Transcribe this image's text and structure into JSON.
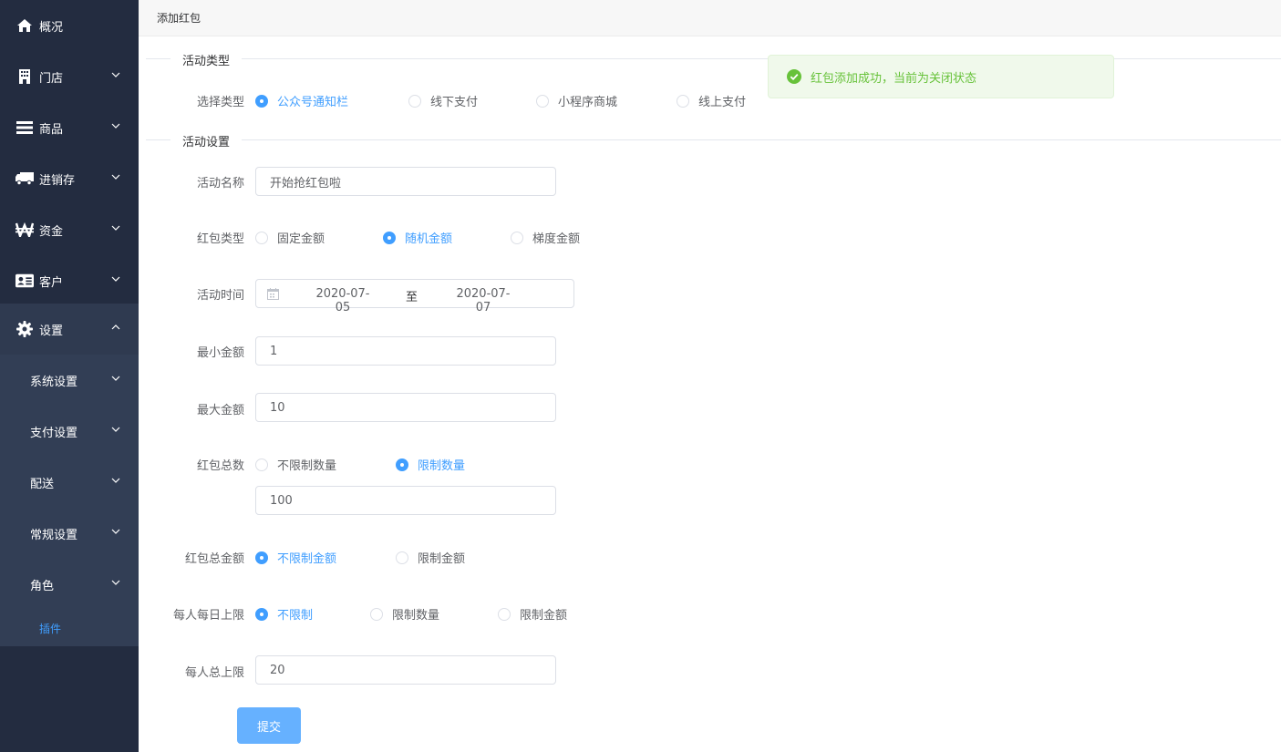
{
  "header": {
    "title": "添加红包"
  },
  "sidebar": {
    "items": [
      {
        "label": "概况",
        "icon": "home-icon"
      },
      {
        "label": "门店",
        "icon": "building-icon"
      },
      {
        "label": "商品",
        "icon": "list-icon"
      },
      {
        "label": "进销存",
        "icon": "truck-icon"
      },
      {
        "label": "资金",
        "icon": "won-icon"
      },
      {
        "label": "客户",
        "icon": "id-card-icon"
      },
      {
        "label": "设置",
        "icon": "gear-icon"
      }
    ],
    "submenu": [
      {
        "label": "系统设置"
      },
      {
        "label": "支付设置"
      },
      {
        "label": "配送"
      },
      {
        "label": "常规设置"
      },
      {
        "label": "角色"
      },
      {
        "label": "插件"
      }
    ]
  },
  "sections": {
    "type_title": "活动类型",
    "settings_title": "活动设置"
  },
  "form": {
    "activity_type": {
      "label": "选择类型",
      "options": [
        "公众号通知栏",
        "线下支付",
        "小程序商城",
        "线上支付"
      ],
      "selected": 0
    },
    "name": {
      "label": "活动名称",
      "value": "开始抢红包啦"
    },
    "packet_type": {
      "label": "红包类型",
      "options": [
        "固定金额",
        "随机金额",
        "梯度金额"
      ],
      "selected": 1
    },
    "time": {
      "label": "活动时间",
      "start": "2020-07-05",
      "separator": "至",
      "end": "2020-07-07"
    },
    "min_amount": {
      "label": "最小金额",
      "value": "1"
    },
    "max_amount": {
      "label": "最大金额",
      "value": "10"
    },
    "total_count": {
      "label": "红包总数",
      "options": [
        "不限制数量",
        "限制数量"
      ],
      "selected": 1,
      "value": "100"
    },
    "total_amount": {
      "label": "红包总金额",
      "options": [
        "不限制金额",
        "限制金额"
      ],
      "selected": 0
    },
    "daily_limit": {
      "label": "每人每日上限",
      "options": [
        "不限制",
        "限制数量",
        "限制金额"
      ],
      "selected": 0
    },
    "total_limit": {
      "label": "每人总上限",
      "value": "20"
    },
    "submit_label": "提交"
  },
  "toast": {
    "message": "红包添加成功，当前为关闭状态"
  },
  "colors": {
    "sidebar_bg": "#232c40",
    "accent": "#409eff",
    "success": "#67c23a"
  }
}
